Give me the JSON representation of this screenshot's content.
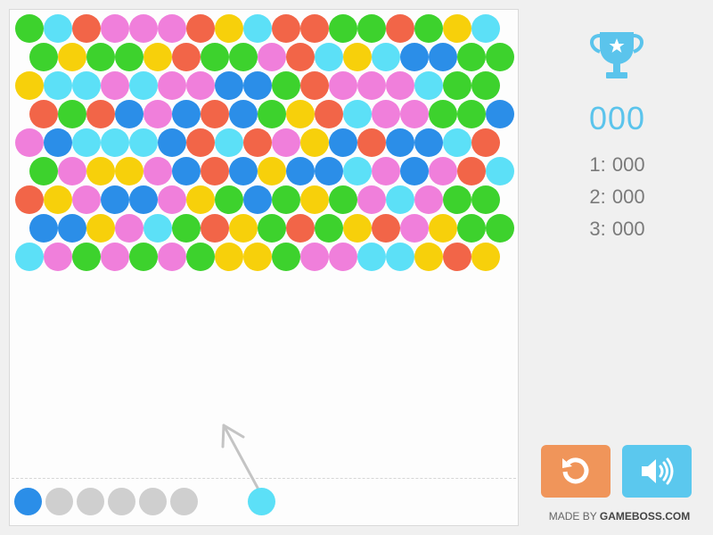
{
  "colors": {
    "G": "#3dd22d",
    "C": "#5ce0f7",
    "R": "#f26548",
    "P": "#f07fdb",
    "Y": "#f7d00b",
    "B": "#2b8ee8",
    "queued_empty": "#cfcfcf",
    "accent": "#5bc4ec"
  },
  "grid": [
    "GCRPPPRYCRRGGRGYC",
    "GYGGYRGGPRCYCBBGG",
    "YCCPCPPBBGRPPPCGG",
    "RGRBPBRBGYRCPPGGB",
    "PBCCCBRCRPYBRBBCR",
    "GPYYPBRBYBBCPBPRC",
    "RYPBBPYGBGYGPCPGG",
    "BBYPCGRYGRGYRPYGG",
    "CPGPGPGYYGPPCCYRY"
  ],
  "queue": [
    "B",
    null,
    null,
    null,
    null,
    null
  ],
  "current_bubble": "C",
  "aim_icon": "aim-arrow-icon",
  "score": "000",
  "high_scores": [
    {
      "rank": "1",
      "score": "000"
    },
    {
      "rank": "2",
      "score": "000"
    },
    {
      "rank": "3",
      "score": "000"
    }
  ],
  "icons": {
    "trophy": "trophy-icon",
    "restart": "restart-icon",
    "sound": "speaker-icon"
  },
  "credit": {
    "prefix": "MADE BY",
    "brand": "GAMEBOSS.COM"
  }
}
